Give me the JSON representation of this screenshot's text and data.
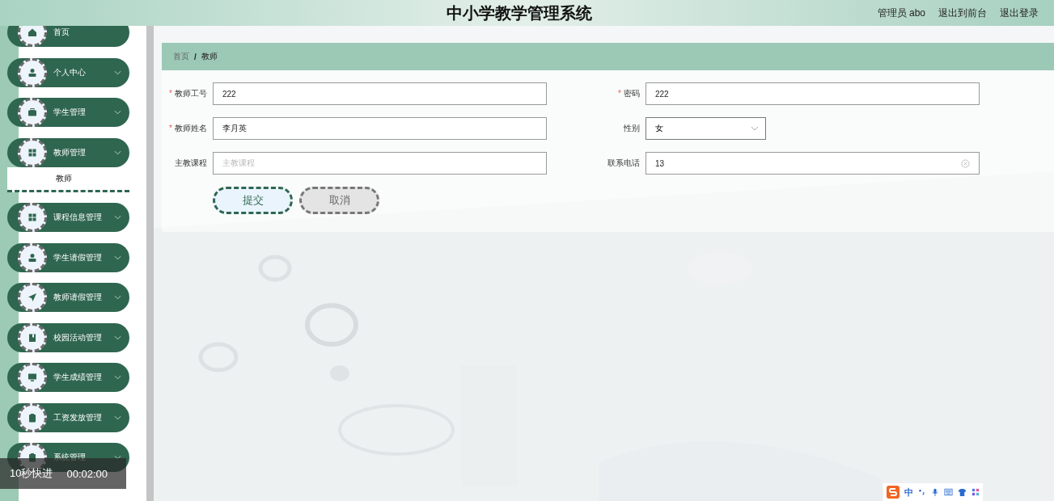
{
  "header": {
    "title": "中小学教学管理系统",
    "user": "管理员 abo",
    "links": [
      "退出到前台",
      "退出登录"
    ]
  },
  "sidebar": {
    "items": [
      {
        "label": "首页",
        "kind": "link"
      },
      {
        "label": "个人中心",
        "kind": "menu"
      },
      {
        "label": "学生管理",
        "kind": "menu"
      },
      {
        "label": "教师管理",
        "kind": "menu",
        "children": [
          {
            "label": "教师"
          }
        ]
      },
      {
        "label": "课程信息管理",
        "kind": "menu"
      },
      {
        "label": "学生请假管理",
        "kind": "menu"
      },
      {
        "label": "教师请假管理",
        "kind": "menu"
      },
      {
        "label": "校园活动管理",
        "kind": "menu"
      },
      {
        "label": "学生成绩管理",
        "kind": "menu"
      },
      {
        "label": "工资发放管理",
        "kind": "menu"
      },
      {
        "label": "系统管理",
        "kind": "menu"
      }
    ]
  },
  "breadcrumb": {
    "items": [
      "首页",
      "教师"
    ],
    "separator": "/"
  },
  "form": {
    "fields": [
      {
        "label": "教师工号",
        "required_mark": "*",
        "kind": "text",
        "value": "222"
      },
      {
        "label": "密码",
        "required_mark": "*",
        "kind": "text",
        "value": "222"
      },
      {
        "label": "教师姓名",
        "required_mark": "*",
        "kind": "text",
        "value": "李月英"
      },
      {
        "label": "性别",
        "kind": "select",
        "value": "女"
      },
      {
        "label": "主教课程",
        "kind": "text",
        "placeholder": "主教课程"
      },
      {
        "label": "联系电话",
        "kind": "text",
        "value": "13",
        "clearable": true
      }
    ],
    "buttons": [
      {
        "label": "提交",
        "kind": "primary"
      },
      {
        "label": "取消",
        "kind": "secondary"
      }
    ]
  },
  "video_overlay": {
    "skip": "10秒快进",
    "time": "00:02:00"
  },
  "ime_toolbar": {
    "mode": "中"
  }
}
